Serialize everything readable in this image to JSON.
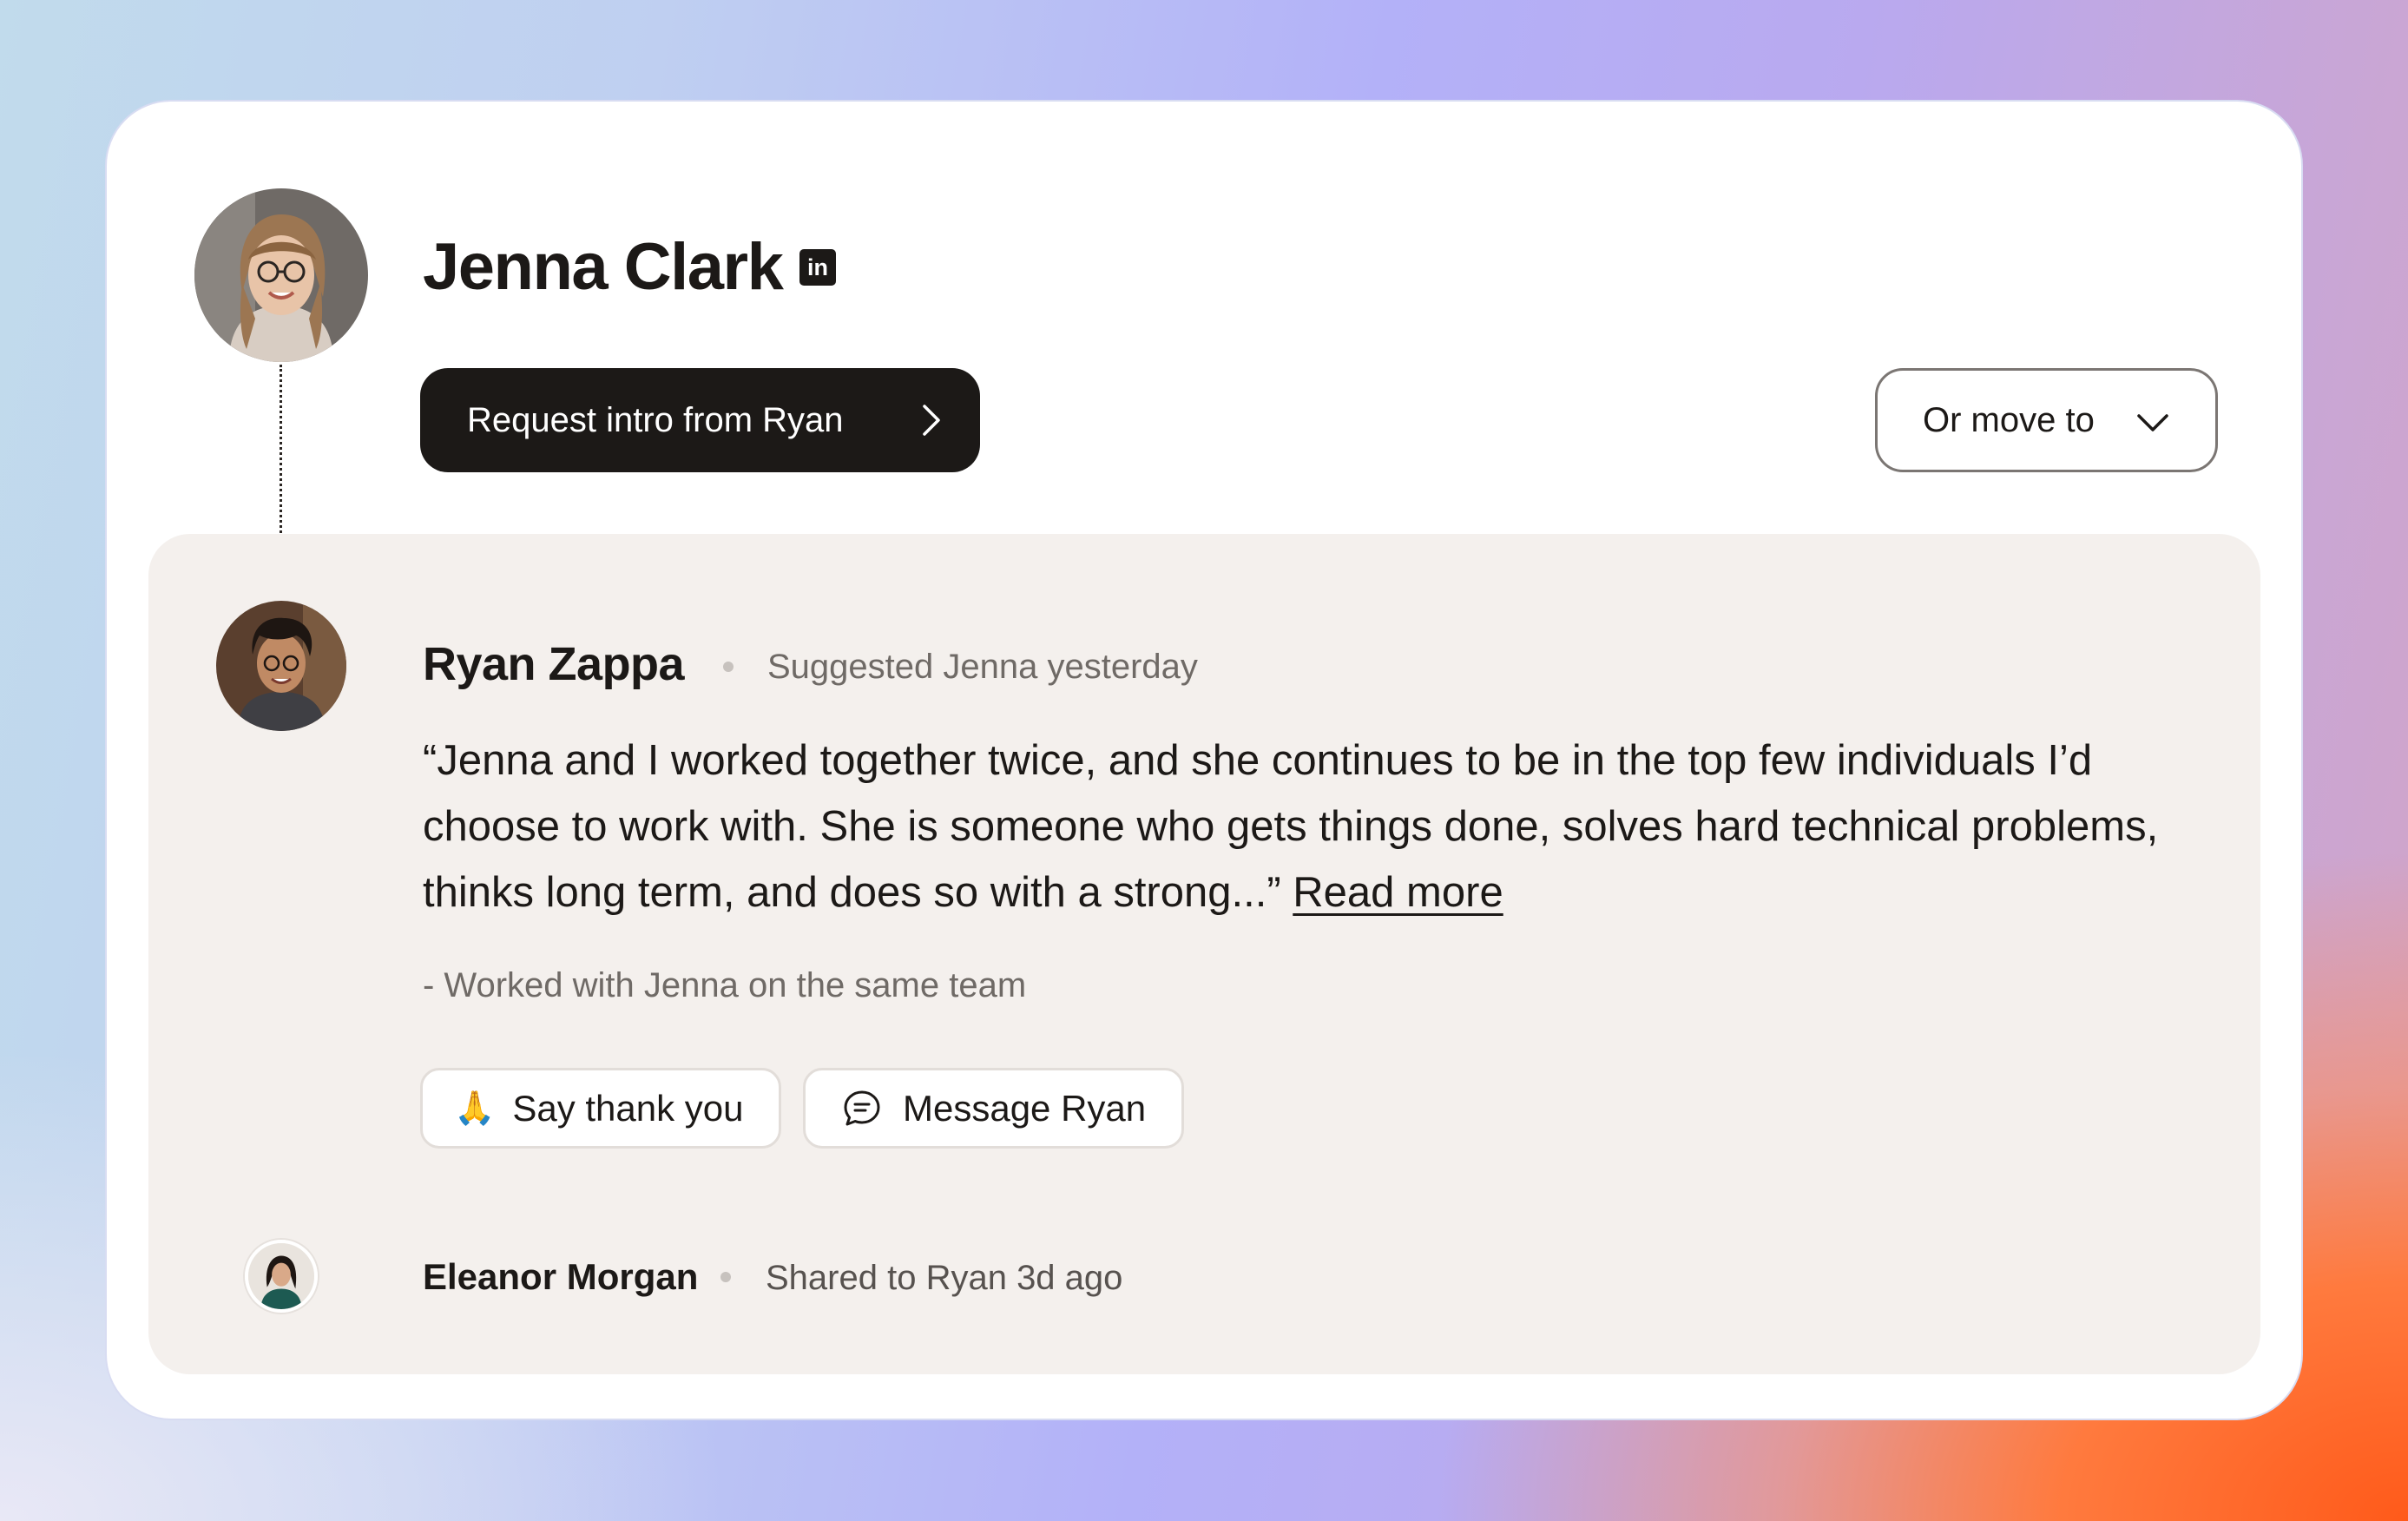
{
  "profile": {
    "name": "Jenna Clark",
    "linkedin_icon": "linkedin-icon",
    "linkedin_label": "in",
    "avatar": "avatar-woman-glasses"
  },
  "actions": {
    "request_intro_label": "Request intro from Ryan",
    "move_to_label": "Or move to"
  },
  "suggestion": {
    "author": "Ryan Zappa",
    "meta": "Suggested Jenna yesterday",
    "quote": "“Jenna and I worked together twice, and she continues to be in the top few individuals I’d choose to work with. She is someone who gets things done, solves hard technical problems, thinks long term, and does so with a strong...”",
    "read_more": "Read more",
    "context": "- Worked with Jenna on the same team",
    "thank_emoji": "🙏",
    "thank_label": "Say thank you",
    "message_label": "Message Ryan"
  },
  "share": {
    "author": "Eleanor Morgan",
    "meta": "Shared to Ryan 3d ago"
  },
  "colors": {
    "primary_button": "#1c1917",
    "panel_bg": "#f4f0ed",
    "muted_text": "#6f6a66"
  }
}
